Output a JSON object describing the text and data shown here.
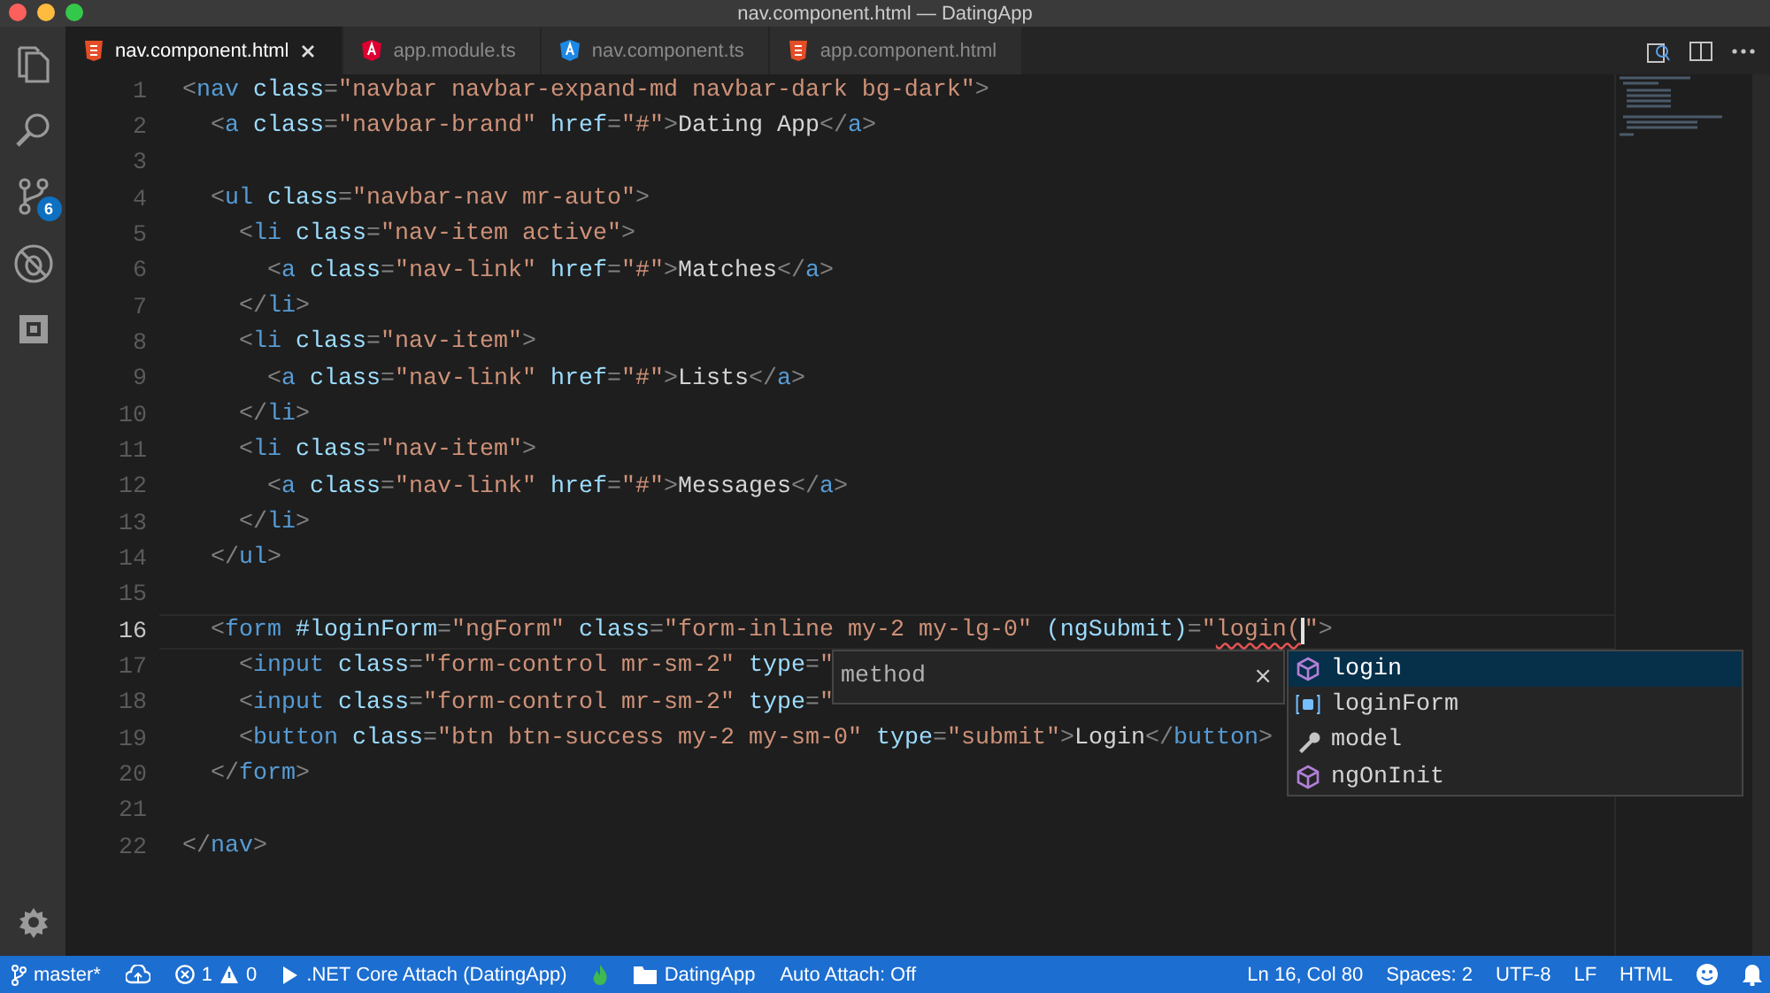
{
  "window": {
    "title": "nav.component.html — DatingApp"
  },
  "activity_bar": {
    "source_control_badge": "6"
  },
  "tabs": [
    {
      "label": "nav.component.html",
      "kind": "html",
      "selected": true
    },
    {
      "label": "app.module.ts",
      "kind": "ng-module",
      "selected": false
    },
    {
      "label": "nav.component.ts",
      "kind": "ng-component",
      "selected": false
    },
    {
      "label": "app.component.html",
      "kind": "html",
      "selected": false
    }
  ],
  "editor": {
    "lines": [
      {
        "number": "1",
        "current": false,
        "tokens": [
          {
            "kind": "punct",
            "text": "<"
          },
          {
            "kind": "tag",
            "text": "nav"
          },
          {
            "kind": "attr",
            "text": " class"
          },
          {
            "kind": "punct",
            "text": "="
          },
          {
            "kind": "string",
            "text": "\"navbar navbar-expand-md navbar-dark bg-dark\""
          },
          {
            "kind": "punct",
            "text": ">"
          }
        ]
      },
      {
        "number": "2",
        "current": false,
        "tokens": [
          {
            "kind": "punct",
            "text": "  <"
          },
          {
            "kind": "tag",
            "text": "a"
          },
          {
            "kind": "attr",
            "text": " class"
          },
          {
            "kind": "punct",
            "text": "="
          },
          {
            "kind": "string",
            "text": "\"navbar-brand\""
          },
          {
            "kind": "attr",
            "text": " href"
          },
          {
            "kind": "punct",
            "text": "="
          },
          {
            "kind": "string",
            "text": "\"#\""
          },
          {
            "kind": "punct",
            "text": ">"
          },
          {
            "kind": "text",
            "text": "Dating App"
          },
          {
            "kind": "punct",
            "text": "</"
          },
          {
            "kind": "tag",
            "text": "a"
          },
          {
            "kind": "punct",
            "text": ">"
          }
        ]
      },
      {
        "number": "3",
        "current": false
      },
      {
        "number": "4",
        "current": false,
        "tokens": [
          {
            "kind": "punct",
            "text": "  <"
          },
          {
            "kind": "tag",
            "text": "ul"
          },
          {
            "kind": "attr",
            "text": " class"
          },
          {
            "kind": "punct",
            "text": "="
          },
          {
            "kind": "string",
            "text": "\"navbar-nav mr-auto\""
          },
          {
            "kind": "punct",
            "text": ">"
          }
        ]
      },
      {
        "number": "5",
        "current": false,
        "tokens": [
          {
            "kind": "punct",
            "text": "    <"
          },
          {
            "kind": "tag",
            "text": "li"
          },
          {
            "kind": "attr",
            "text": " class"
          },
          {
            "kind": "punct",
            "text": "="
          },
          {
            "kind": "string",
            "text": "\"nav-item active\""
          },
          {
            "kind": "punct",
            "text": ">"
          }
        ]
      },
      {
        "number": "6",
        "current": false,
        "tokens": [
          {
            "kind": "punct",
            "text": "      <"
          },
          {
            "kind": "tag",
            "text": "a"
          },
          {
            "kind": "attr",
            "text": " class"
          },
          {
            "kind": "punct",
            "text": "="
          },
          {
            "kind": "string",
            "text": "\"nav-link\""
          },
          {
            "kind": "attr",
            "text": " href"
          },
          {
            "kind": "punct",
            "text": "="
          },
          {
            "kind": "string",
            "text": "\"#\""
          },
          {
            "kind": "punct",
            "text": ">"
          },
          {
            "kind": "text",
            "text": "Matches"
          },
          {
            "kind": "punct",
            "text": "</"
          },
          {
            "kind": "tag",
            "text": "a"
          },
          {
            "kind": "punct",
            "text": ">"
          }
        ]
      },
      {
        "number": "7",
        "current": false,
        "tokens": [
          {
            "kind": "punct",
            "text": "    </"
          },
          {
            "kind": "tag",
            "text": "li"
          },
          {
            "kind": "punct",
            "text": ">"
          }
        ]
      },
      {
        "number": "8",
        "current": false,
        "tokens": [
          {
            "kind": "punct",
            "text": "    <"
          },
          {
            "kind": "tag",
            "text": "li"
          },
          {
            "kind": "attr",
            "text": " class"
          },
          {
            "kind": "punct",
            "text": "="
          },
          {
            "kind": "string",
            "text": "\"nav-item\""
          },
          {
            "kind": "punct",
            "text": ">"
          }
        ]
      },
      {
        "number": "9",
        "current": false,
        "tokens": [
          {
            "kind": "punct",
            "text": "      <"
          },
          {
            "kind": "tag",
            "text": "a"
          },
          {
            "kind": "attr",
            "text": " class"
          },
          {
            "kind": "punct",
            "text": "="
          },
          {
            "kind": "string",
            "text": "\"nav-link\""
          },
          {
            "kind": "attr",
            "text": " href"
          },
          {
            "kind": "punct",
            "text": "="
          },
          {
            "kind": "string",
            "text": "\"#\""
          },
          {
            "kind": "punct",
            "text": ">"
          },
          {
            "kind": "text",
            "text": "Lists"
          },
          {
            "kind": "punct",
            "text": "</"
          },
          {
            "kind": "tag",
            "text": "a"
          },
          {
            "kind": "punct",
            "text": ">"
          }
        ]
      },
      {
        "number": "10",
        "current": false,
        "tokens": [
          {
            "kind": "punct",
            "text": "    </"
          },
          {
            "kind": "tag",
            "text": "li"
          },
          {
            "kind": "punct",
            "text": ">"
          }
        ]
      },
      {
        "number": "11",
        "current": false,
        "tokens": [
          {
            "kind": "punct",
            "text": "    <"
          },
          {
            "kind": "tag",
            "text": "li"
          },
          {
            "kind": "attr",
            "text": " class"
          },
          {
            "kind": "punct",
            "text": "="
          },
          {
            "kind": "string",
            "text": "\"nav-item\""
          },
          {
            "kind": "punct",
            "text": ">"
          }
        ]
      },
      {
        "number": "12",
        "current": false,
        "tokens": [
          {
            "kind": "punct",
            "text": "      <"
          },
          {
            "kind": "tag",
            "text": "a"
          },
          {
            "kind": "attr",
            "text": " class"
          },
          {
            "kind": "punct",
            "text": "="
          },
          {
            "kind": "string",
            "text": "\"nav-link\""
          },
          {
            "kind": "attr",
            "text": " href"
          },
          {
            "kind": "punct",
            "text": "="
          },
          {
            "kind": "string",
            "text": "\"#\""
          },
          {
            "kind": "punct",
            "text": ">"
          },
          {
            "kind": "text",
            "text": "Messages"
          },
          {
            "kind": "punct",
            "text": "</"
          },
          {
            "kind": "tag",
            "text": "a"
          },
          {
            "kind": "punct",
            "text": ">"
          }
        ]
      },
      {
        "number": "13",
        "current": false,
        "tokens": [
          {
            "kind": "punct",
            "text": "    </"
          },
          {
            "kind": "tag",
            "text": "li"
          },
          {
            "kind": "punct",
            "text": ">"
          }
        ]
      },
      {
        "number": "14",
        "current": false,
        "tokens": [
          {
            "kind": "punct",
            "text": "  </"
          },
          {
            "kind": "tag",
            "text": "ul"
          },
          {
            "kind": "punct",
            "text": ">"
          }
        ]
      },
      {
        "number": "15",
        "current": false
      },
      {
        "number": "16",
        "current": true,
        "tokens": [
          {
            "kind": "punct",
            "text": "  <"
          },
          {
            "kind": "tag",
            "text": "form"
          },
          {
            "kind": "attr",
            "text": " #loginForm"
          },
          {
            "kind": "punct",
            "text": "="
          },
          {
            "kind": "string",
            "text": "\"ngForm\""
          },
          {
            "kind": "attr",
            "text": " class"
          },
          {
            "kind": "punct",
            "text": "="
          },
          {
            "kind": "string",
            "text": "\"form-inline my-2 my-lg-0\""
          },
          {
            "kind": "attr",
            "text": " (ngSubmit)"
          },
          {
            "kind": "punct",
            "text": "="
          },
          {
            "kind": "string",
            "text": "\""
          },
          {
            "kind": "error",
            "text": "login("
          },
          {
            "kind": "string",
            "text": "\""
          },
          {
            "kind": "punct",
            "text": ">"
          }
        ]
      },
      {
        "number": "17",
        "current": false,
        "tokens": [
          {
            "kind": "punct",
            "text": "    <"
          },
          {
            "kind": "tag",
            "text": "input"
          },
          {
            "kind": "attr",
            "text": " class"
          },
          {
            "kind": "punct",
            "text": "="
          },
          {
            "kind": "string",
            "text": "\"form-control mr-sm-2\""
          },
          {
            "kind": "attr",
            "text": " type"
          },
          {
            "kind": "punct",
            "text": "="
          },
          {
            "kind": "string",
            "text": "\""
          }
        ]
      },
      {
        "number": "18",
        "current": false,
        "tokens": [
          {
            "kind": "punct",
            "text": "    <"
          },
          {
            "kind": "tag",
            "text": "input"
          },
          {
            "kind": "attr",
            "text": " class"
          },
          {
            "kind": "punct",
            "text": "="
          },
          {
            "kind": "string",
            "text": "\"form-control mr-sm-2\""
          },
          {
            "kind": "attr",
            "text": " type"
          },
          {
            "kind": "punct",
            "text": "="
          },
          {
            "kind": "string",
            "text": "\""
          }
        ]
      },
      {
        "number": "19",
        "current": false,
        "tokens": [
          {
            "kind": "punct",
            "text": "    <"
          },
          {
            "kind": "tag",
            "text": "button"
          },
          {
            "kind": "attr",
            "text": " class"
          },
          {
            "kind": "punct",
            "text": "="
          },
          {
            "kind": "string",
            "text": "\"btn btn-success my-2 my-sm-0\""
          },
          {
            "kind": "attr",
            "text": " type"
          },
          {
            "kind": "punct",
            "text": "="
          },
          {
            "kind": "string",
            "text": "\"submit\""
          },
          {
            "kind": "punct",
            "text": ">"
          },
          {
            "kind": "text",
            "text": "Login"
          },
          {
            "kind": "punct",
            "text": "</"
          },
          {
            "kind": "tag",
            "text": "button"
          },
          {
            "kind": "punct",
            "text": ">"
          }
        ]
      },
      {
        "number": "20",
        "current": false,
        "tokens": [
          {
            "kind": "punct",
            "text": "  </"
          },
          {
            "kind": "tag",
            "text": "form"
          },
          {
            "kind": "punct",
            "text": ">"
          }
        ]
      },
      {
        "number": "21",
        "current": false
      },
      {
        "number": "22",
        "current": false,
        "tokens": [
          {
            "kind": "punct",
            "text": "</"
          },
          {
            "kind": "tag",
            "text": "nav"
          },
          {
            "kind": "punct",
            "text": ">"
          }
        ]
      }
    ]
  },
  "suggest_details": {
    "text": "method",
    "close": "×"
  },
  "suggestions": [
    {
      "label": "login",
      "kind": "method",
      "selected": true
    },
    {
      "label": "loginForm",
      "kind": "variable",
      "selected": false
    },
    {
      "label": "model",
      "kind": "property",
      "selected": false
    },
    {
      "label": "ngOnInit",
      "kind": "method",
      "selected": false
    }
  ],
  "status_bar": {
    "left": [
      {
        "kind": "branch",
        "text": "master*"
      },
      {
        "kind": "sync"
      },
      {
        "kind": "problems",
        "errors": "1",
        "warnings": "0"
      },
      {
        "kind": "debug",
        "text": ".NET Core Attach (DatingApp)"
      },
      {
        "kind": "flame"
      },
      {
        "kind": "folder",
        "text": "DatingApp"
      },
      {
        "kind": "plain",
        "text": "Auto Attach: Off"
      }
    ],
    "right": [
      {
        "kind": "plain",
        "text": "Ln 16, Col 80"
      },
      {
        "kind": "plain",
        "text": "Spaces: 2"
      },
      {
        "kind": "plain",
        "text": "UTF-8"
      },
      {
        "kind": "plain",
        "text": "LF"
      },
      {
        "kind": "plain",
        "text": "HTML"
      },
      {
        "kind": "feedback"
      },
      {
        "kind": "bell"
      }
    ]
  }
}
